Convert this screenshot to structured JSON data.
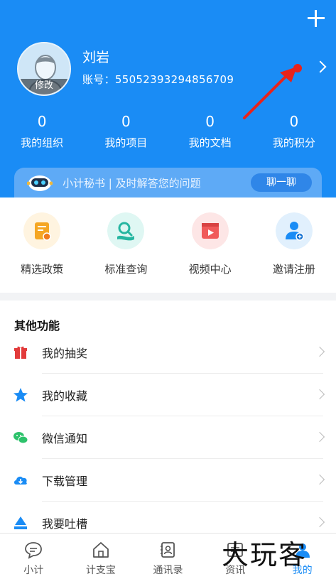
{
  "profile": {
    "name": "刘岩",
    "account": "账号：55052393294856709",
    "avatar_edit": "修改"
  },
  "stats": [
    {
      "value": "0",
      "label": "我的组织"
    },
    {
      "value": "0",
      "label": "我的项目"
    },
    {
      "value": "0",
      "label": "我的文档"
    },
    {
      "value": "0",
      "label": "我的积分"
    }
  ],
  "secretary": {
    "text": "小计秘书 | 及时解答您的问题",
    "button": "聊一聊"
  },
  "quick": [
    {
      "label": "精选政策",
      "icon": "policy-icon"
    },
    {
      "label": "标准查询",
      "icon": "standard-search-icon"
    },
    {
      "label": "视频中心",
      "icon": "video-icon"
    },
    {
      "label": "邀请注册",
      "icon": "invite-icon"
    }
  ],
  "other": {
    "title": "其他功能",
    "items": [
      {
        "label": "我的抽奖",
        "icon": "gift-icon"
      },
      {
        "label": "我的收藏",
        "icon": "star-icon"
      },
      {
        "label": "微信通知",
        "icon": "wechat-icon"
      },
      {
        "label": "下载管理",
        "icon": "cloud-download-icon"
      },
      {
        "label": "我要吐槽",
        "icon": "feedback-icon"
      }
    ]
  },
  "nav": [
    {
      "label": "小计",
      "icon": "chat-icon"
    },
    {
      "label": "计支宝",
      "icon": "home-icon"
    },
    {
      "label": "通讯录",
      "icon": "contacts-icon"
    },
    {
      "label": "资讯",
      "icon": "news-icon"
    },
    {
      "label": "我的",
      "icon": "me-icon",
      "active": true
    }
  ],
  "watermark": "大玩客",
  "colors": {
    "brand": "#1a8cf5",
    "red_marker": "#e8231b"
  }
}
